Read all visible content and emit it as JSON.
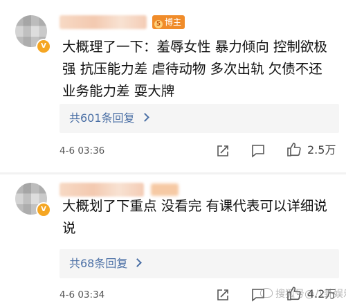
{
  "comments": [
    {
      "badge": "博主",
      "text": "大概理了一下：羞辱女性 暴力倾向 控制欲极强 抗压能力差 虐待动物 多次出轨 欠债不还 业务能力差 耍大牌",
      "replies_label": "共601条回复",
      "timestamp": "4-6 03:36",
      "likes": "2.5万",
      "icons": [
        "share-icon",
        "comment-icon",
        "like-icon"
      ]
    },
    {
      "text": "大概划了下重点 没看完 有课代表可以详细说说",
      "replies_label": "共68条回复",
      "timestamp": "4-6 03:34",
      "likes": "4.2万",
      "icons": [
        "share-icon",
        "comment-icon",
        "like-icon"
      ]
    }
  ],
  "watermark": "搜狐号@八卦娱乐"
}
